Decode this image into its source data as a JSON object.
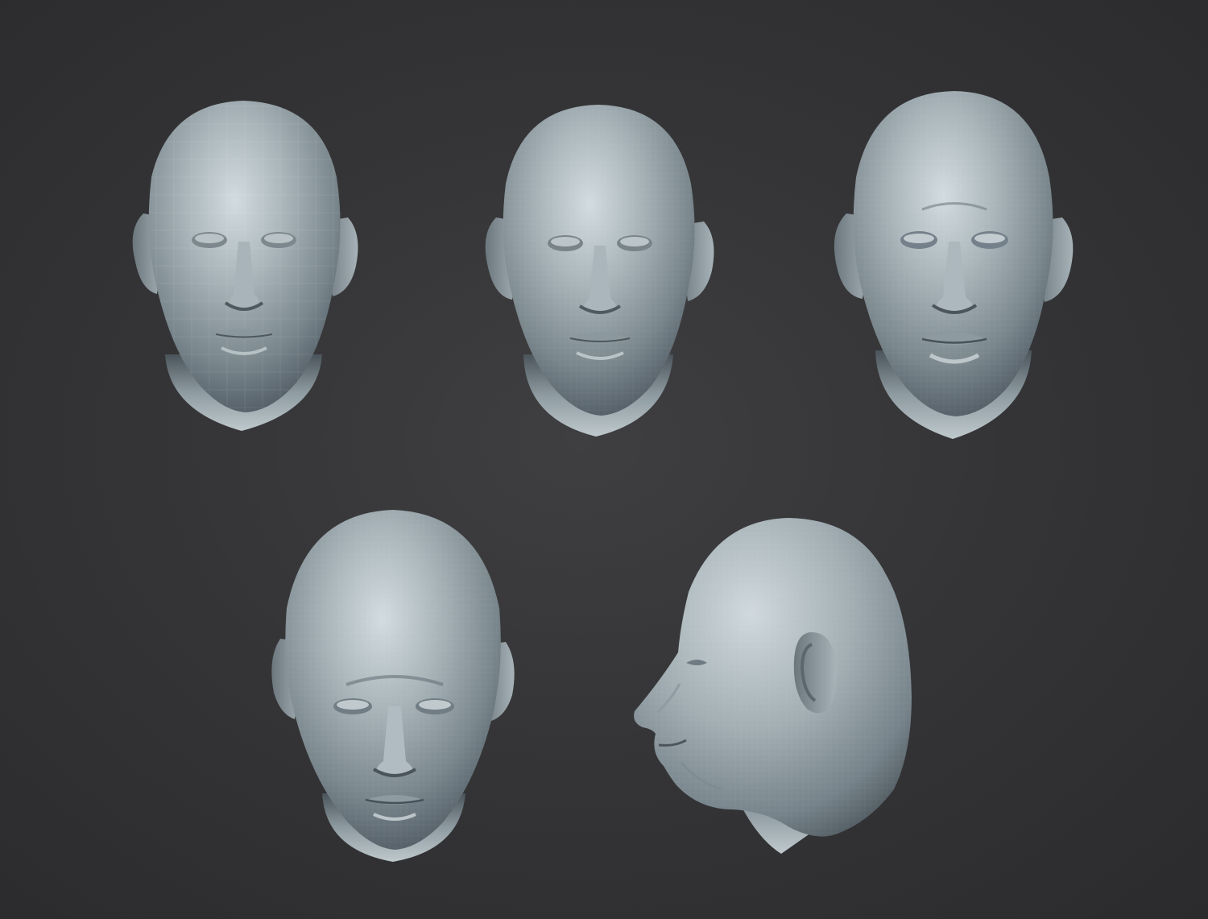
{
  "scene": {
    "background_color": "#333335",
    "sculpt_base_color": "#8d9ba1",
    "sculpt_highlight_color": "#c9d3d7",
    "sculpt_shadow_color": "#3b4448",
    "views": [
      {
        "view": "front",
        "detail_level": "low"
      },
      {
        "view": "front",
        "detail_level": "medium"
      },
      {
        "view": "front",
        "detail_level": "high"
      },
      {
        "view": "front-high-angle",
        "detail_level": "high"
      },
      {
        "view": "three-quarter-profile",
        "detail_level": "high"
      }
    ]
  }
}
